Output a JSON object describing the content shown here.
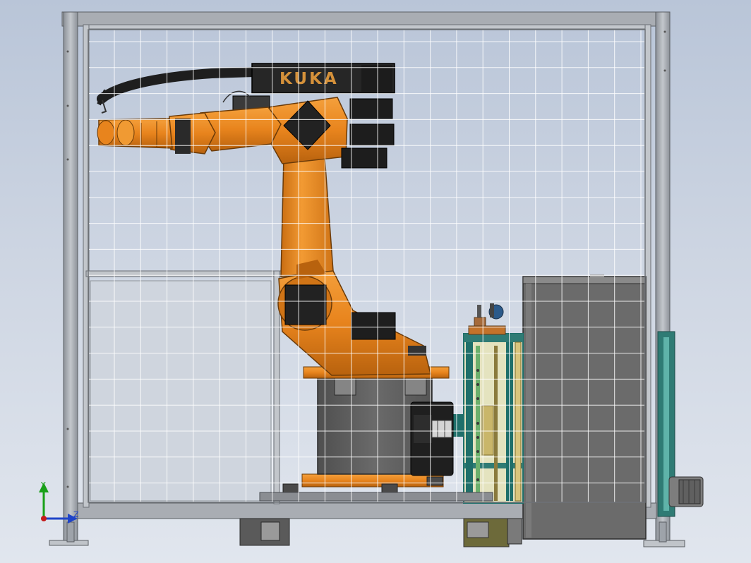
{
  "robot": {
    "brand": "KUKA"
  },
  "triad": {
    "y_label": "Y",
    "z_label": "Z"
  },
  "colors": {
    "background_top": "#b9c5d8",
    "frame": "#9ea3aa",
    "robot_orange": "#e8841d",
    "motor_black": "#222222",
    "base_gray": "#5e5e5e",
    "cabinet_gray": "#6b6b6b",
    "rack_teal": "#1f6f6a",
    "mesh": "#ffffff"
  }
}
